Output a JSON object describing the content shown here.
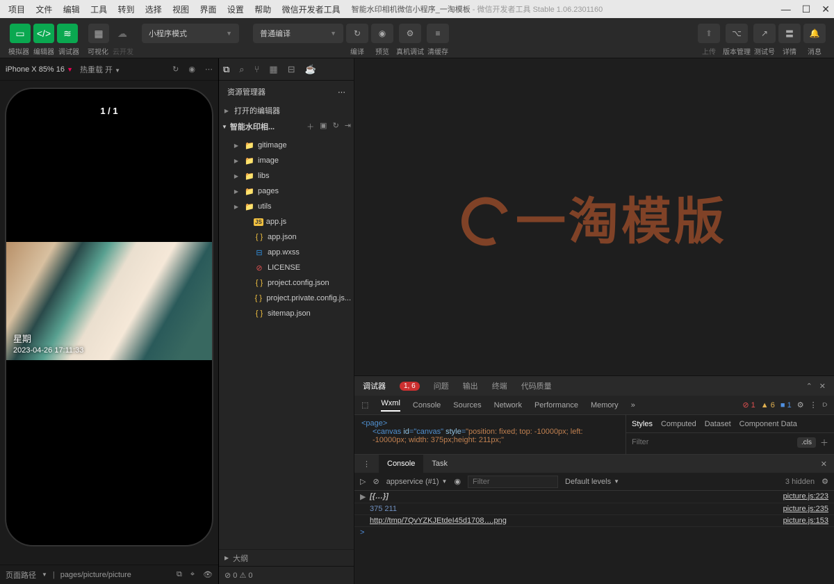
{
  "menubar": [
    "项目",
    "文件",
    "编辑",
    "工具",
    "转到",
    "选择",
    "视图",
    "界面",
    "设置",
    "帮助",
    "微信开发者工具"
  ],
  "title": {
    "main": "智能水印相机微信小程序_一淘模板",
    "suffix": " - 微信开发者工具 Stable 1.06.2301160"
  },
  "toolbar": {
    "labels": {
      "sim": "模拟器",
      "editor": "编辑器",
      "dbg": "调试器",
      "vis": "可视化",
      "cloud": "云开发"
    },
    "mode": "小程序模式",
    "compile": "普通编译",
    "actions": {
      "compile": "编译",
      "preview": "预览",
      "real": "真机调试",
      "clear": "清缓存",
      "upload": "上传",
      "ver": "版本管理",
      "test": "测试号",
      "detail": "详情",
      "msg": "消息"
    }
  },
  "sim": {
    "device": "iPhone X 85% 16",
    "hot": "热重载 开",
    "counter": "1 / 1",
    "wm_day": "星期",
    "wm_ts": "2023-04-26 17:11:33",
    "pathlabel": "页面路径",
    "path": "pages/picture/picture"
  },
  "explorer": {
    "title": "资源管理器",
    "openEditors": "打开的编辑器",
    "project": "智能水印相...",
    "tree": [
      {
        "icon": "folder",
        "name": "gitimage",
        "exp": true
      },
      {
        "icon": "folder2",
        "name": "image",
        "exp": true
      },
      {
        "icon": "folder3",
        "name": "libs",
        "exp": true
      },
      {
        "icon": "folder3",
        "name": "pages",
        "exp": true
      },
      {
        "icon": "folder2",
        "name": "utils",
        "exp": true
      },
      {
        "icon": "js",
        "name": "app.js"
      },
      {
        "icon": "json",
        "name": "app.json"
      },
      {
        "icon": "wxss",
        "name": "app.wxss"
      },
      {
        "icon": "lic",
        "name": "LICENSE"
      },
      {
        "icon": "json",
        "name": "project.config.json"
      },
      {
        "icon": "json",
        "name": "project.private.config.js..."
      },
      {
        "icon": "json",
        "name": "sitemap.json"
      }
    ],
    "outline": "大纲",
    "errs": "⊘ 0 ⚠ 0"
  },
  "watermark": "一淘模版",
  "debugger": {
    "tabs": {
      "main": "调试器",
      "badge": "1, 6",
      "issue": "问题",
      "output": "输出",
      "terminal": "终端",
      "quality": "代码质量"
    },
    "devtabs": [
      "Wxml",
      "Console",
      "Sources",
      "Network",
      "Performance",
      "Memory"
    ],
    "counts": {
      "err": "1",
      "warn": "6",
      "info": "1"
    },
    "code": {
      "l1_open": "<page>",
      "l2a": "<canvas ",
      "l2b": "id",
      "l2c": "=\"canvas\" ",
      "l2d": "style",
      "l2e": "=",
      "l2f": "\"position: fixed; top: -10000px; left: -10000px; width: 375px;height: 211px;\""
    },
    "styles": {
      "tabs": [
        "Styles",
        "Computed",
        "Dataset",
        "Component Data"
      ],
      "filter": "Filter",
      "cls": ".cls"
    },
    "console": {
      "tabs": [
        "Console",
        "Task"
      ],
      "ctx": "appservice (#1)",
      "filter": "Filter",
      "levels": "Default levels",
      "hidden": "3 hidden",
      "lines": [
        {
          "exp": "▶",
          "msg": "[{…}]",
          "src": "picture.js:223",
          "type": "it"
        },
        {
          "exp": "",
          "msg": "375 211",
          "src": "picture.js:235",
          "type": "dim"
        },
        {
          "exp": "",
          "msg": "http://tmp/7QvYZKJEtdeI45d1708….png",
          "src": "picture.js:153",
          "type": "url"
        }
      ],
      "prompt": ">"
    }
  }
}
